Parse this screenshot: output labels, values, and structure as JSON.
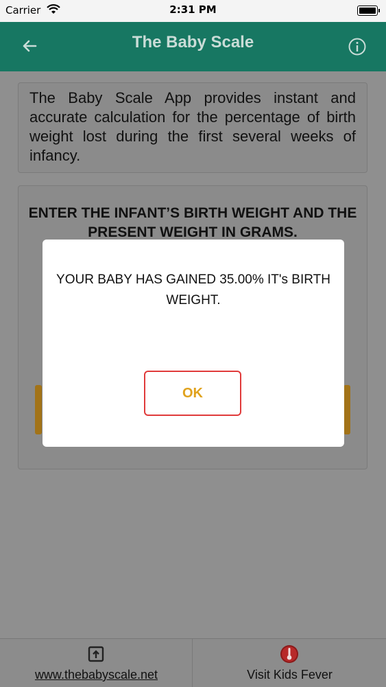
{
  "status_bar": {
    "carrier": "Carrier",
    "time": "2:31 PM"
  },
  "nav": {
    "title": "The Baby Scale"
  },
  "intro": {
    "text": "The Baby Scale App provides instant and accurate calculation for the percentage of birth weight lost during the first several weeks of infancy."
  },
  "input_card": {
    "instruction": "ENTER THE INFANT’S BIRTH WEIGHT AND THE PRESENT WEIGHT IN GRAMS."
  },
  "alert": {
    "message": "YOUR BABY HAS GAINED 35.00% IT's BIRTH WEIGHT.",
    "ok_label": "OK"
  },
  "footer": {
    "website_label": "www.thebabyscale.net",
    "kids_fever_label": "Visit Kids Fever"
  },
  "colors": {
    "nav_bar": "#177762",
    "ok_border": "#e03a3a",
    "ok_text": "#e0a21d",
    "accent_button": "#a27318"
  },
  "icons": {
    "back": "arrow-left-icon",
    "info": "info-circle-icon",
    "website": "external-link-icon",
    "kids_fever": "thermometer-icon",
    "wifi": "wifi-icon",
    "battery": "battery-icon"
  }
}
